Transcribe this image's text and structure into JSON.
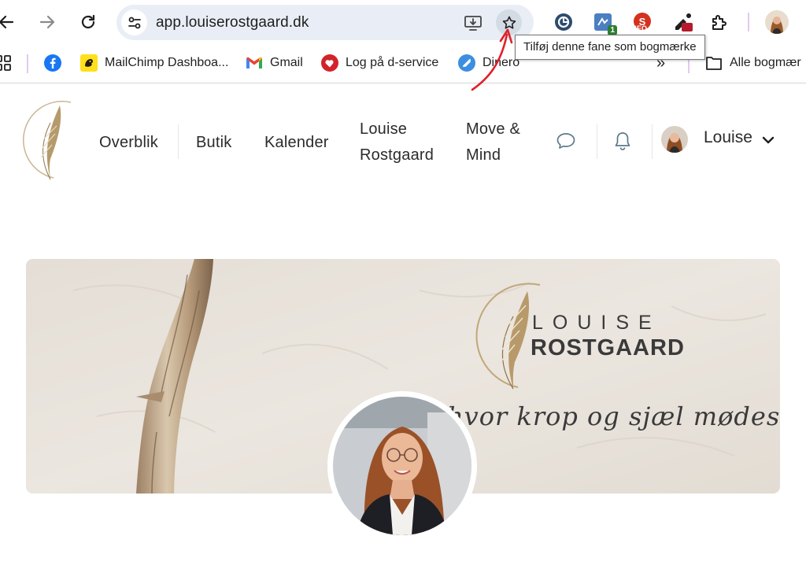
{
  "browser": {
    "url": "app.louiserostgaard.dk",
    "tooltip": "Tilføj denne fane som bogmærke",
    "extensions": [
      {
        "name": "grammar-check-icon"
      },
      {
        "name": "extension-green-icon",
        "badge": "1"
      },
      {
        "name": "seo-extension-icon",
        "label": "SEO"
      },
      {
        "name": "color-picker-icon"
      },
      {
        "name": "extensions-puzzle-icon"
      }
    ]
  },
  "bookmarks": {
    "items": [
      {
        "label": "MailChimp Dashboa..."
      },
      {
        "label": "Gmail"
      },
      {
        "label": "Log på d-service"
      },
      {
        "label": "Dinero"
      }
    ],
    "overflow": "»",
    "all_bookmarks": "Alle bogmær"
  },
  "nav": {
    "items": [
      {
        "label": "Overblik"
      },
      {
        "label": "Butik"
      },
      {
        "label": "Kalender"
      },
      {
        "label_line1": "Louise",
        "label_line2": "Rostgaard"
      },
      {
        "label_line1": "Move &",
        "label_line2": "Mind"
      }
    ],
    "user_name": "Louise"
  },
  "cover": {
    "brand_line1": "LOUISE",
    "brand_line2": "ROSTGAARD",
    "tagline": "hvor krop og sjæl mødes"
  },
  "colors": {
    "accent_red": "#e0202a",
    "gold": "#b89a6a",
    "cover_bg": "#e6e0d8"
  }
}
